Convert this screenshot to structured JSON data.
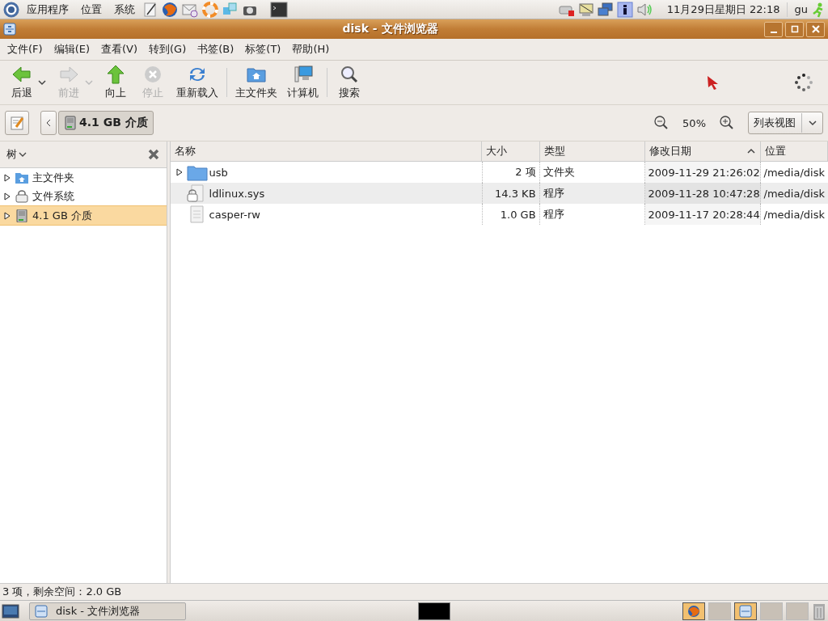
{
  "top_panel": {
    "menus": [
      "应用程序",
      "位置",
      "系统"
    ],
    "clock": "11月29日星期日 22:18",
    "user": "gu"
  },
  "window": {
    "title": "disk - 文件浏览器"
  },
  "menubar": [
    "文件(F)",
    "编辑(E)",
    "查看(V)",
    "转到(G)",
    "书签(B)",
    "标签(T)",
    "帮助(H)"
  ],
  "toolbar": [
    {
      "label": "后退",
      "kind": "back",
      "disabled": false,
      "dropdown": true
    },
    {
      "label": "前进",
      "kind": "forward",
      "disabled": true,
      "dropdown": true
    },
    {
      "label": "向上",
      "kind": "up",
      "disabled": false,
      "dropdown": false
    },
    {
      "label": "停止",
      "kind": "stop",
      "disabled": true,
      "dropdown": false
    },
    {
      "label": "重新载入",
      "kind": "reload",
      "disabled": false,
      "dropdown": false
    },
    {
      "label": "主文件夹",
      "kind": "home",
      "disabled": false,
      "dropdown": false
    },
    {
      "label": "计算机",
      "kind": "computer",
      "disabled": false,
      "dropdown": false
    },
    {
      "label": "搜索",
      "kind": "search",
      "disabled": false,
      "dropdown": false
    }
  ],
  "location_bar": {
    "path_button": "4.1 GB 介质",
    "zoom": "50%",
    "view_select": "列表视图"
  },
  "sidebar": {
    "title": "树",
    "items": [
      {
        "label": "主文件夹",
        "kind": "home",
        "selected": false
      },
      {
        "label": "文件系统",
        "kind": "filesystem",
        "selected": false
      },
      {
        "label": "4.1 GB 介质",
        "kind": "drive",
        "selected": true
      }
    ]
  },
  "file_list": {
    "columns": [
      {
        "label": "名称",
        "sorted": false
      },
      {
        "label": "大小",
        "sorted": false
      },
      {
        "label": "类型",
        "sorted": false
      },
      {
        "label": "修改日期",
        "sorted": true
      },
      {
        "label": "位置",
        "sorted": false
      }
    ],
    "rows": [
      {
        "name": "usb",
        "size": "2 项",
        "type": "文件夹",
        "modified": "2009-11-29 21:26:02",
        "location": "/media/disk",
        "kind": "folder"
      },
      {
        "name": "ldlinux.sys",
        "size": "14.3 KB",
        "type": "程序",
        "modified": "2009-11-28 10:47:28",
        "location": "/media/disk",
        "kind": "locked-file"
      },
      {
        "name": "casper-rw",
        "size": "1.0 GB",
        "type": "程序",
        "modified": "2009-11-17 20:28:44",
        "location": "/media/disk",
        "kind": "file"
      }
    ]
  },
  "status_bar": "3 项，剩余空间：2.0 GB",
  "taskbar": {
    "windows": [
      "disk - 文件浏览器"
    ]
  }
}
